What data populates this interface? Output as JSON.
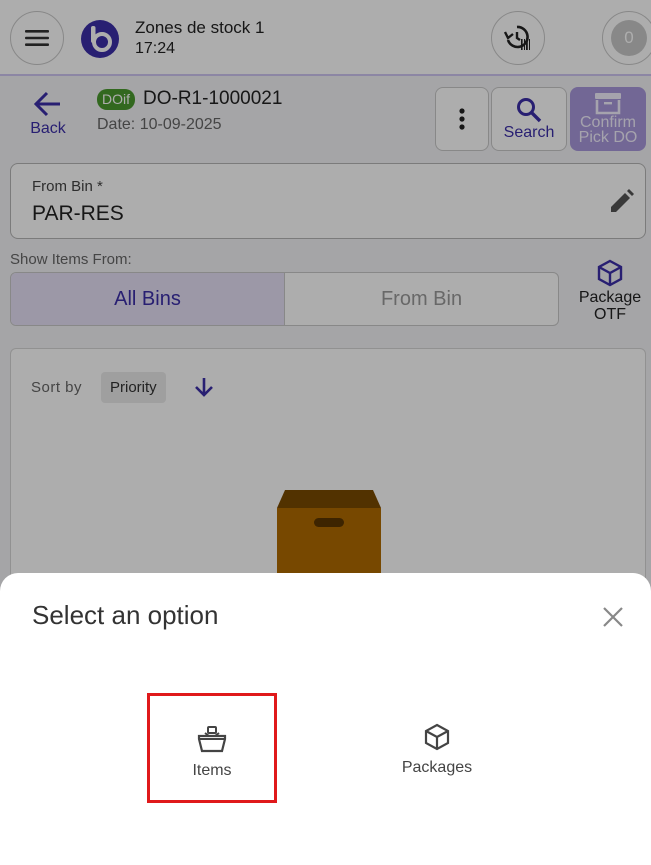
{
  "app": {
    "store_title": "Zones de stock 1",
    "store_time": "17:24",
    "count_badge": "0"
  },
  "header": {
    "back_label": "Back",
    "doc_badge": "DOif",
    "doc_number": "DO-R1-1000021",
    "doc_date": "Date: 10-09-2025",
    "search_label": "Search",
    "confirm_label_line1": "Confirm",
    "confirm_label_line2": "Pick DO"
  },
  "from_bin": {
    "label": "From Bin *",
    "value": "PAR-RES"
  },
  "show_items": {
    "label": "Show Items From:",
    "options": [
      "All Bins",
      "From Bin"
    ],
    "selected": "All Bins"
  },
  "package_otf": {
    "line1": "Package",
    "line2": "OTF"
  },
  "list": {
    "sort_label": "Sort by",
    "sort_value": "Priority"
  },
  "sheet": {
    "title": "Select an option",
    "options": [
      {
        "label": "Items",
        "icon": "basket-icon",
        "highlighted": true
      },
      {
        "label": "Packages",
        "icon": "package-icon",
        "highlighted": false
      }
    ]
  },
  "colors": {
    "accent": "#3b2ea8",
    "badge_green": "#4a9a2e",
    "highlight_red": "#e0191b",
    "box_brown": "#b06a00"
  }
}
